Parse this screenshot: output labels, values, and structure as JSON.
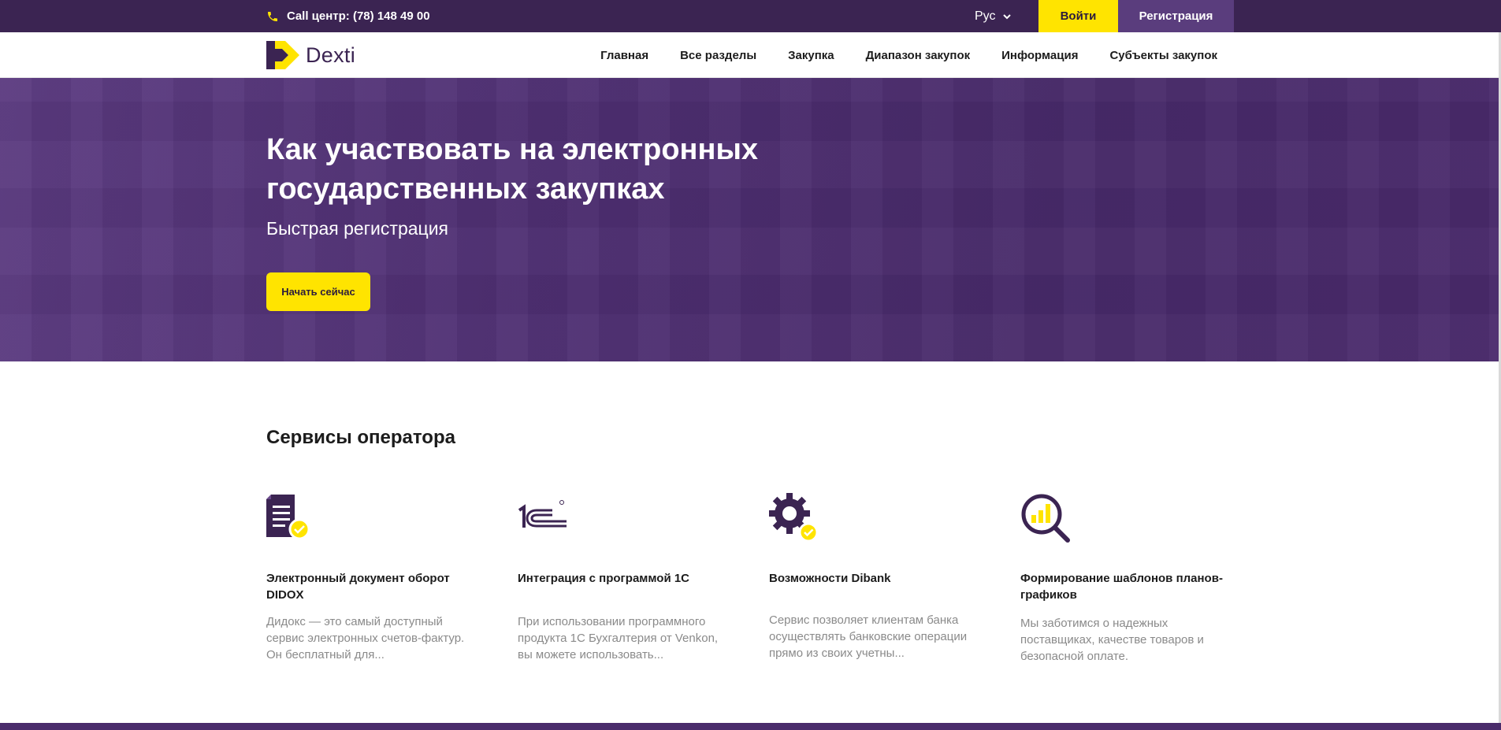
{
  "topbar": {
    "phone_label": "Call центр: (78) 148 49 00",
    "language": "Рус",
    "login_label": "Войти",
    "register_label": "Регистрация"
  },
  "logo": {
    "text": "Dexti"
  },
  "nav": {
    "items": [
      "Главная",
      "Все разделы",
      "Закупка",
      "Диапазон закупок",
      "Информация",
      "Субъекты закупок"
    ]
  },
  "hero": {
    "title": "Как участвовать на электронных государственных закупках",
    "subtitle": "Быстрая регистрация",
    "cta_label": "Начать сейчас"
  },
  "services": {
    "title": "Сервисы оператора",
    "cards": [
      {
        "icon": "document-check-icon",
        "title": "Электронный документ оборот DIDOX",
        "desc": "Дидокс — это самый доступный сервис электронных счетов-фактур. Он бесплатный для..."
      },
      {
        "icon": "1c-logo-icon",
        "title": "Интеграция с программой 1С",
        "desc": "При использовании программного продукта 1С Бухгалтерия от Venkon, вы можете использовать..."
      },
      {
        "icon": "gear-check-icon",
        "title": "Возможности Dibank",
        "desc": "Сервис позволяет клиентам банка осуществлять банковские операции прямо из своих учетны..."
      },
      {
        "icon": "magnifier-chart-icon",
        "title": "Формирование шаблонов планов-графиков",
        "desc": "Мы заботимся о надежных поставщиках, качестве товаров и безопасной оплате."
      }
    ]
  },
  "colors": {
    "primary": "#3b2452",
    "accent": "#ffe400",
    "hero": "#4f2f73"
  }
}
